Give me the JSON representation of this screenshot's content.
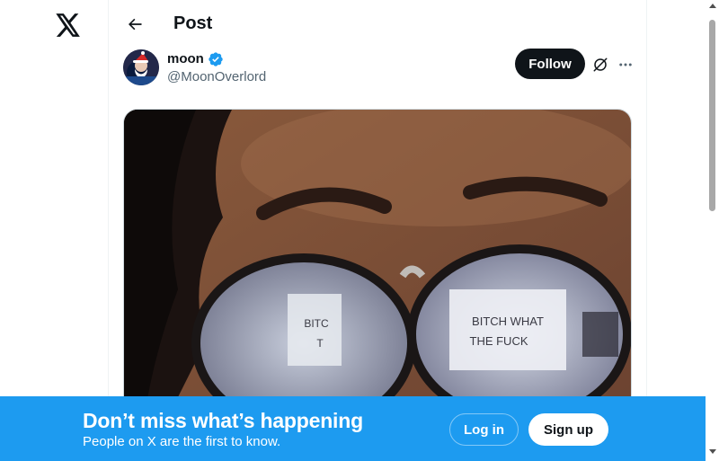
{
  "rail": {
    "logo_icon": "x-logo-icon"
  },
  "header": {
    "back_icon": "arrow-left-icon",
    "title": "Post"
  },
  "post": {
    "author_name": "moon",
    "verified_icon": "verified-badge-icon",
    "author_handle": "@MoonOverlord",
    "follow_label": "Follow",
    "grok_icon": "grok-icon",
    "more_icon": "more-horizontal-icon",
    "media": {
      "description_icon": "photo-image",
      "sign_text_right": "BITCH WHAT THE FUCK",
      "sign_text_left": "BITC T"
    }
  },
  "banner": {
    "title": "Don’t miss what’s happening",
    "subtitle": "People on X are the first to know.",
    "login_label": "Log in",
    "signup_label": "Sign up"
  },
  "colors": {
    "accent": "#1d9bf0",
    "text": "#0f1419",
    "secondary_text": "#536471",
    "follow_bg": "#0f1419"
  }
}
